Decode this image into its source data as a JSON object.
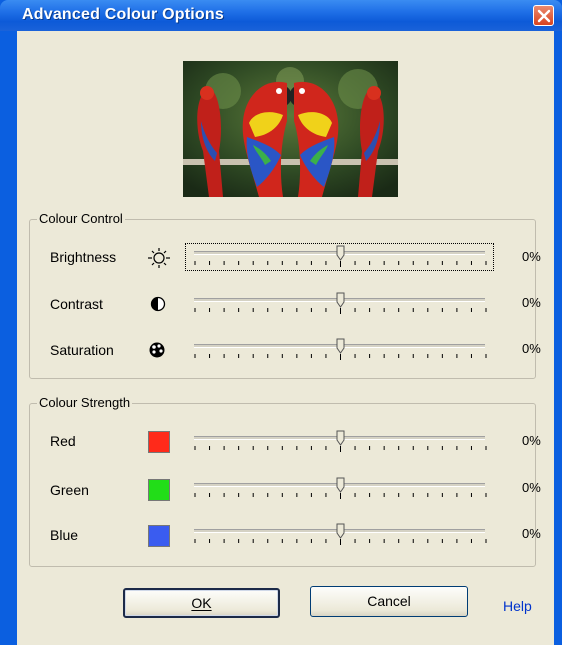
{
  "window": {
    "title": "Advanced Colour Options",
    "close_icon": "close-icon"
  },
  "colour_control": {
    "legend": "Colour Control",
    "rows": [
      {
        "label": "Brightness",
        "icon": "sun-icon",
        "value_text": "0%",
        "value_fraction": 0.5
      },
      {
        "label": "Contrast",
        "icon": "contrast-icon",
        "value_text": "0%",
        "value_fraction": 0.5
      },
      {
        "label": "Saturation",
        "icon": "palette-icon",
        "value_text": "0%",
        "value_fraction": 0.5
      }
    ]
  },
  "colour_strength": {
    "legend": "Colour Strength",
    "rows": [
      {
        "label": "Red",
        "swatch": "#ff2a1a",
        "value_text": "0%",
        "value_fraction": 0.5
      },
      {
        "label": "Green",
        "swatch": "#22dd18",
        "value_text": "0%",
        "value_fraction": 0.5
      },
      {
        "label": "Blue",
        "swatch": "#3a5cf0",
        "value_text": "0%",
        "value_fraction": 0.5
      }
    ]
  },
  "buttons": {
    "ok": "OK",
    "cancel": "Cancel",
    "help": "Help"
  }
}
